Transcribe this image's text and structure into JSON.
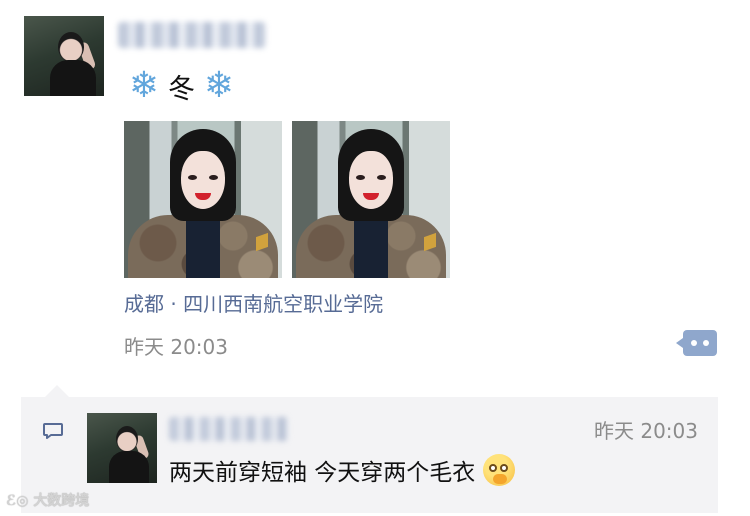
{
  "post": {
    "author_name_blurred": true,
    "text": "冬",
    "emoji_left": "❄",
    "emoji_right": "❄",
    "photo_count": 2,
    "location": "成都 · 四川西南航空职业学院",
    "timestamp": "昨天 20:03",
    "more_button_color": "#8fa7cc",
    "location_color": "#576b95"
  },
  "comment": {
    "author_name_blurred": true,
    "time": "昨天 20:03",
    "text": "两天前穿短袖 今天穿两个毛衣",
    "emoji": "face-with-hand-emoji",
    "background_color": "#f3f3f5"
  },
  "watermark": {
    "text": "大数跨境"
  }
}
